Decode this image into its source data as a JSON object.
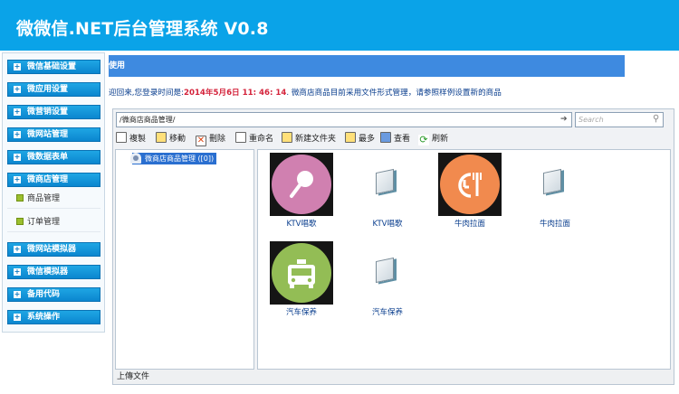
{
  "header": {
    "title": "微微信.NET后台管理系统 V0.8"
  },
  "sidebar": {
    "menus_top": [
      "微信基础设置",
      "微应用设置",
      "微营销设置",
      "微网站管理",
      "微数据表单",
      "微商店管理"
    ],
    "sub_items": [
      "商品管理",
      "订单管理"
    ],
    "menus_bottom": [
      "微网站模拟器",
      "微信模拟器",
      "备用代码",
      "系统操作"
    ]
  },
  "tab": {
    "label": "使用"
  },
  "welcome": {
    "prefix": "迎回来,您登录时间是:",
    "datetime": "2014年5月6日 11: 46: 14",
    "suffix": ". 微商店商品目前采用文件形式管理，请参照样例设置新的商品"
  },
  "filemanager": {
    "address": "/微商店商品管理/",
    "search_placeholder": "Search",
    "toolbar": [
      "複製",
      "移動",
      "刪除",
      "重命名",
      "新建文件夹",
      "最多",
      "查看",
      "刷新"
    ],
    "tree_node": "微商店商品管理 ([0])",
    "items": [
      {
        "label": "KTV唱歌",
        "type": "image",
        "icon": "microphone-icon",
        "color": "#d080b0"
      },
      {
        "label": "KTV唱歌",
        "type": "file",
        "icon": "file-icon"
      },
      {
        "label": "牛肉拉面",
        "type": "image",
        "icon": "fork-clock-icon",
        "color": "#f18a4e"
      },
      {
        "label": "牛肉拉面",
        "type": "file",
        "icon": "file-icon"
      },
      {
        "label": "汽车保养",
        "type": "image",
        "icon": "car-icon",
        "color": "#93bd55"
      },
      {
        "label": "汽车保养",
        "type": "file",
        "icon": "file-icon"
      }
    ],
    "status": "上傳文件"
  }
}
